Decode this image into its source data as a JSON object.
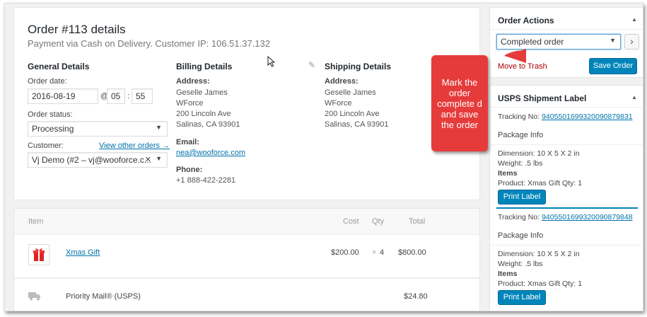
{
  "order": {
    "title": "Order #113 details",
    "subtitle": "Payment via Cash on Delivery. Customer IP: 106.51.37.132"
  },
  "general": {
    "heading": "General Details",
    "date_label": "Order date:",
    "date_value": "2016-08-19",
    "at": "@",
    "hour": "05",
    "colon": ":",
    "minute": "55",
    "status_label": "Order status:",
    "status_value": "Processing",
    "customer_label": "Customer:",
    "view_other": "View other orders →",
    "customer_value": "Vj Demo (#2 – vj@wooforce.c..."
  },
  "billing": {
    "heading": "Billing Details",
    "address_label": "Address:",
    "address_lines": [
      "Geselle James",
      "WForce",
      "200 Lincoln Ave",
      "Salinas, CA 93901"
    ],
    "email_label": "Email:",
    "email_value": "nea@wooforce.com",
    "phone_label": "Phone:",
    "phone_value": "+1 888-422-2281"
  },
  "shipping": {
    "heading": "Shipping Details",
    "address_label": "Address:",
    "address_lines": [
      "Geselle James",
      "WForce",
      "200 Lincoln Ave",
      "Salinas, CA 93901"
    ]
  },
  "items": {
    "headers": {
      "item": "Item",
      "cost": "Cost",
      "qty": "Qty",
      "total": "Total"
    },
    "rows": [
      {
        "name": "Xmas Gift",
        "cost": "$200.00",
        "qty_x": "×",
        "qty": "4",
        "total": "$800.00"
      }
    ],
    "shipping_row": {
      "name": "Priority Mail® (USPS)",
      "total": "$24.80"
    }
  },
  "order_actions": {
    "title": "Order Actions",
    "selected": "Completed order",
    "go": "›",
    "trash": "Move to Trash",
    "save": "Save Order"
  },
  "usps": {
    "title": "USPS Shipment Label",
    "labels": [
      {
        "tracking_label": "Tracking No:",
        "tracking_value": "9405501699320090879831",
        "package_info": "Package Info",
        "dimension": "Dimension: 10 X 5 X 2 in",
        "weight": "Weight: .5 lbs",
        "items_label": "Items",
        "product": "Product: Xmas Gift Qty: 1",
        "print": "Print Label"
      },
      {
        "tracking_label": "Tracking No:",
        "tracking_value": "9405501699320090879848",
        "package_info": "Package Info",
        "dimension": "Dimension: 10 X 5 X 2 in",
        "weight": "Weight: .5 lbs",
        "items_label": "Items",
        "product": "Product: Xmas Gift Qty: 1",
        "print": "Print Label"
      }
    ]
  },
  "callout": {
    "text": "Mark the order complete d and save the order",
    "color": "#e63b3b"
  },
  "colors": {
    "primary": "#0085ba",
    "link": "#0073aa",
    "callout": "#e63b3b"
  }
}
